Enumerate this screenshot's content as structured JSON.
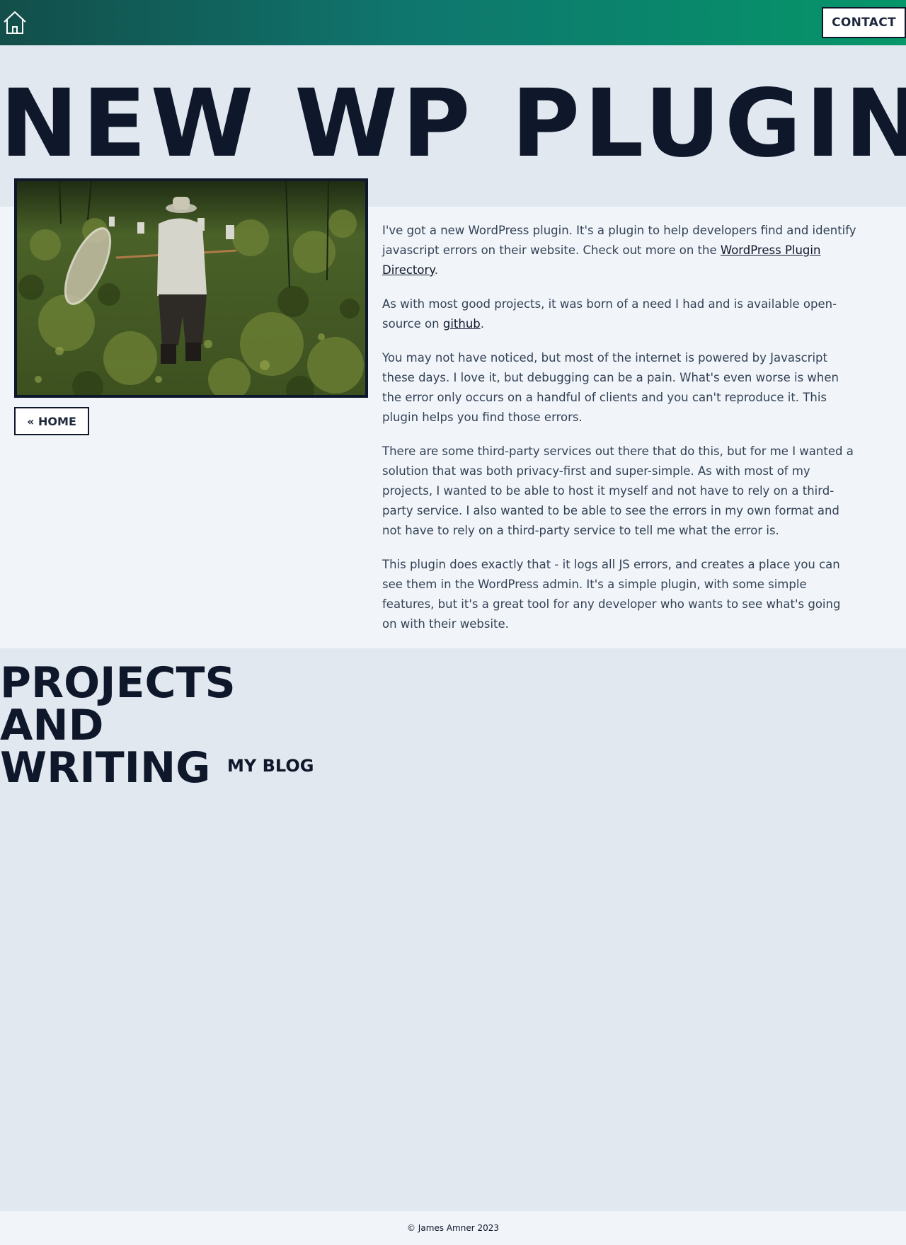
{
  "header": {
    "home_icon": "home-icon",
    "contact_label": "CONTACT",
    "gradient_colors": [
      "#134e4a",
      "#059669"
    ]
  },
  "hero": {
    "title": "NEW WP PLUGIN"
  },
  "nav": {
    "home_back_label": "« HOME"
  },
  "article": {
    "p1_text": "I've got a new WordPress plugin. It's a plugin to help developers find and identify javascript errors on their website. Check out more on the ",
    "p1_link": "WordPress Plugin Directory",
    "p1_end": ".",
    "p2_text": "As with most good projects, it was born of a need I had and is available open-source on ",
    "p2_link": "github",
    "p2_end": ".",
    "p3": "You may not have noticed, but most of the internet is powered by Javascript these days. I love it, but debugging can be a pain. What's even worse is when the error only occurs on a handful of clients and you can't reproduce it. This plugin helps you find those errors.",
    "p4": "There are some third-party services out there that do this, but for me I wanted a solution that was both privacy-first and super-simple. As with most of my projects, I wanted to be able to host it myself and not have to rely on a third-party service. I also wanted to be able to see the errors in my own format and not have to rely on a third-party service to tell me what the error is.",
    "p5": "This plugin does exactly that - it logs all JS errors, and creates a place you can see them in the WordPress admin. It's a simple plugin, with some simple features, but it's a great tool for any developer who wants to see what's going on with their website."
  },
  "projects": {
    "title": "PROJECTS AND WRITING",
    "blog_label": "MY BLOG"
  },
  "footer": {
    "copyright": "© James Amner 2023"
  },
  "colors": {
    "heading": "#0f172a",
    "body_text": "#334155",
    "page_bg": "#e2e8f0",
    "band_bg": "#f1f5f9"
  }
}
